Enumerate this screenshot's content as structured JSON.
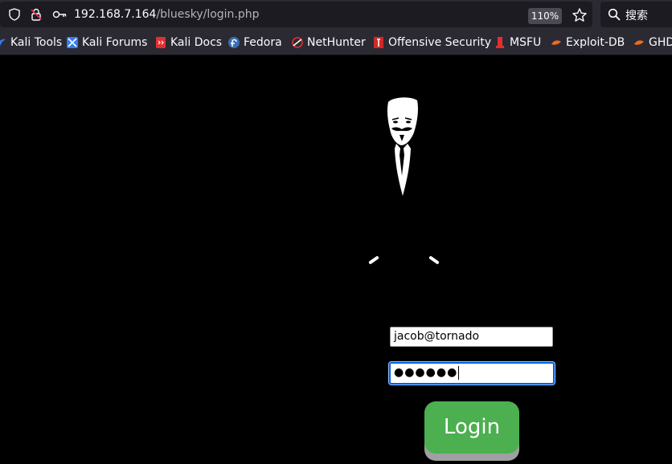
{
  "browser": {
    "url_host": "192.168.7.164",
    "url_path": "/bluesky/login.php",
    "zoom": "110%",
    "search_placeholder": "搜索"
  },
  "bookmarks": [
    {
      "label": "Kali Tools",
      "icon": "kali-icon"
    },
    {
      "label": "Kali Forums",
      "icon": "kali-forums-icon"
    },
    {
      "label": "Kali Docs",
      "icon": "kali-docs-icon"
    },
    {
      "label": "Fedora",
      "icon": "fedora-icon"
    },
    {
      "label": "NetHunter",
      "icon": "nethunter-icon"
    },
    {
      "label": "Offensive Security",
      "icon": "offsec-icon"
    },
    {
      "label": "MSFU",
      "icon": "msfu-icon"
    },
    {
      "label": "Exploit-DB",
      "icon": "exploitdb-icon"
    },
    {
      "label": "GHDB",
      "icon": "ghdb-icon"
    }
  ],
  "login": {
    "email_value": "jacob@tornado",
    "password_masked": "●●●●●●",
    "button_label": "Login"
  },
  "colors": {
    "button": "#4caf50",
    "page_bg": "#000000",
    "chrome_bg": "#2b2a33"
  }
}
